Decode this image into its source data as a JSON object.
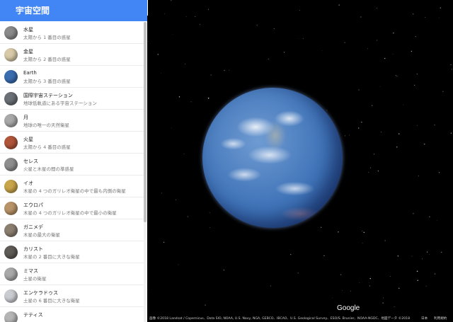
{
  "sidebar": {
    "title": "宇宙空間",
    "items": [
      {
        "name": "水星",
        "description": "太陽から 1 番目の惑星",
        "color": "#8a8a8a"
      },
      {
        "name": "金星",
        "description": "太陽から 2 番目の惑星",
        "color": "#d8caa8"
      },
      {
        "name": "Earth",
        "description": "太陽から 3 番目の惑星",
        "color": "#3a6db0"
      },
      {
        "name": "国際宇宙ステーション",
        "description": "地球低軌道にある宇宙ステーション",
        "color": "#6b6f76"
      },
      {
        "name": "月",
        "description": "地球の唯一の天然衛星",
        "color": "#a9a9a9"
      },
      {
        "name": "火星",
        "description": "太陽から 4 番目の惑星",
        "color": "#b0553a"
      },
      {
        "name": "セレス",
        "description": "火星と木星の間の準惑星",
        "color": "#8e8e8e"
      },
      {
        "name": "イオ",
        "description": "木星の 4 つのガリレオ衛星の中で最も内側の衛星",
        "color": "#c9a54a"
      },
      {
        "name": "エウロパ",
        "description": "木星の 4 つのガリレオ衛星の中で最小の衛星",
        "color": "#b89368"
      },
      {
        "name": "ガニメデ",
        "description": "木星の最大の衛星",
        "color": "#8c7f70"
      },
      {
        "name": "カリスト",
        "description": "木星の 2 番目に大きな衛星",
        "color": "#5e5a55"
      },
      {
        "name": "ミマス",
        "description": "土星の衛星",
        "color": "#a8a8a8"
      },
      {
        "name": "エンケラドゥス",
        "description": "土星の 6 番目に大きな衛星",
        "color": "#c9ccd0"
      },
      {
        "name": "テティス",
        "description": "",
        "color": "#b5b5b5"
      }
    ]
  },
  "collapse_icon": "chevron-left-icon",
  "collapse_glyph": "◂",
  "map": {
    "logo": "Google",
    "attribution": "画像 ©2018 Landsat / Copernicus、Data SIO, NOAA, U.S. Navy, NGA, GEBCO、IBCAO、U.S. Geological Survey、ESO/S. Brunier、NOAA-NGDC、地図データ ©2018",
    "language": "日本",
    "terms": "利用規約"
  }
}
